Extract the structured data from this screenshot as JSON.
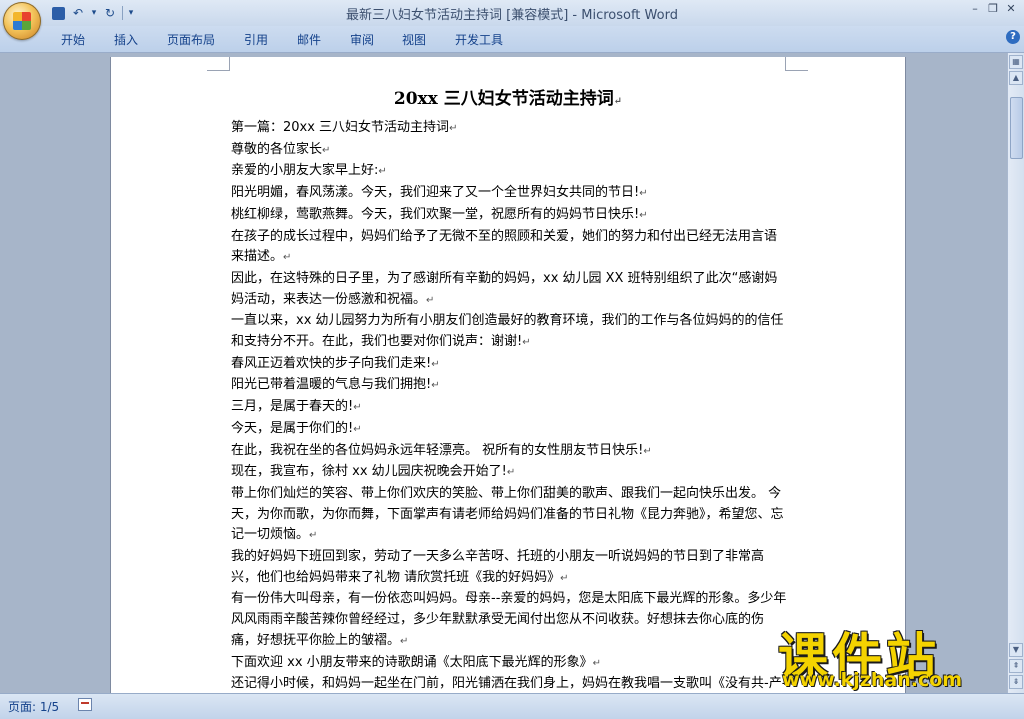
{
  "window": {
    "title": "最新三八妇女节活动主持词 [兼容模式] - Microsoft Word",
    "controls": {
      "minimize": "–",
      "restore": "❐",
      "close": "✕"
    }
  },
  "quick_access": {
    "save_icon": "save-icon",
    "undo_label": "↶",
    "redo_label": "↻",
    "more_label": "▾"
  },
  "ribbon": {
    "tabs": [
      "开始",
      "插入",
      "页面布局",
      "引用",
      "邮件",
      "审阅",
      "视图",
      "开发工具"
    ],
    "help_label": "?"
  },
  "document": {
    "title": "20xx 三八妇女节活动主持词",
    "paragraphs": [
      "第一篇：20xx 三八妇女节活动主持词",
      "尊敬的各位家长",
      "亲爱的小朋友大家早上好:",
      "阳光明媚，春风荡漾。今天，我们迎来了又一个全世界妇女共同的节日!",
      "桃红柳绿，莺歌燕舞。今天，我们欢聚一堂，祝愿所有的妈妈节日快乐!",
      "在孩子的成长过程中，妈妈们给予了无微不至的照顾和关爱，她们的努力和付出已经无法用言语来描述。",
      "因此，在这特殊的日子里，为了感谢所有辛勤的妈妈，xx 幼儿园 XX 班特别组织了此次“感谢妈妈活动，来表达一份感激和祝福。",
      "一直以来，xx 幼儿园努力为所有小朋友们创造最好的教育环境，我们的工作与各位妈妈的的信任和支持分不开。在此，我们也要对你们说声：谢谢!",
      "春风正迈着欢快的步子向我们走来!",
      "阳光已带着温暖的气息与我们拥抱!",
      "三月，是属于春天的!",
      "今天，是属于你们的!",
      "在此，我祝在坐的各位妈妈永远年轻漂亮。 祝所有的女性朋友节日快乐!",
      "现在，我宣布，徐村 xx 幼儿园庆祝晚会开始了!",
      "带上你们灿烂的笑容、带上你们欢庆的笑脸、带上你们甜美的歌声、跟我们一起向快乐出发。 今天，为你而歌，为你而舞，下面掌声有请老师给妈妈们准备的节日礼物《昆力奔驰》，希望您、忘记一切烦恼。",
      "我的好妈妈下班回到家，劳动了一天多么辛苦呀、托班的小朋友一听说妈妈的节日到了非常高兴，他们也给妈妈带来了礼物 请欣赏托班《我的好妈妈》",
      "有一份伟大叫母亲，有一份依恋叫妈妈。母亲--亲爱的妈妈，您是太阳底下最光辉的形象。多少年风风雨雨辛酸苦辣你曾经经过，多少年默默承受无闻付出您从不问收获。好想抹去你心底的伤痛，好想抚平你脸上的皱褶。",
      "下面欢迎 xx 小朋友带来的诗歌朗诵《太阳底下最光辉的形象》",
      "还记得小时候，和妈妈一起坐在门前，阳光铺洒在我们身上，妈妈在教我唱一支歌叫《没有共-产-党就没有新中国》，那种感觉真好，真温暖。下面有请滕姿含、毕若涵小朋友"
    ]
  },
  "status": {
    "page": "页面: 1/5"
  },
  "watermark": {
    "name": "课件站",
    "url": "www.kjzhan.com"
  }
}
